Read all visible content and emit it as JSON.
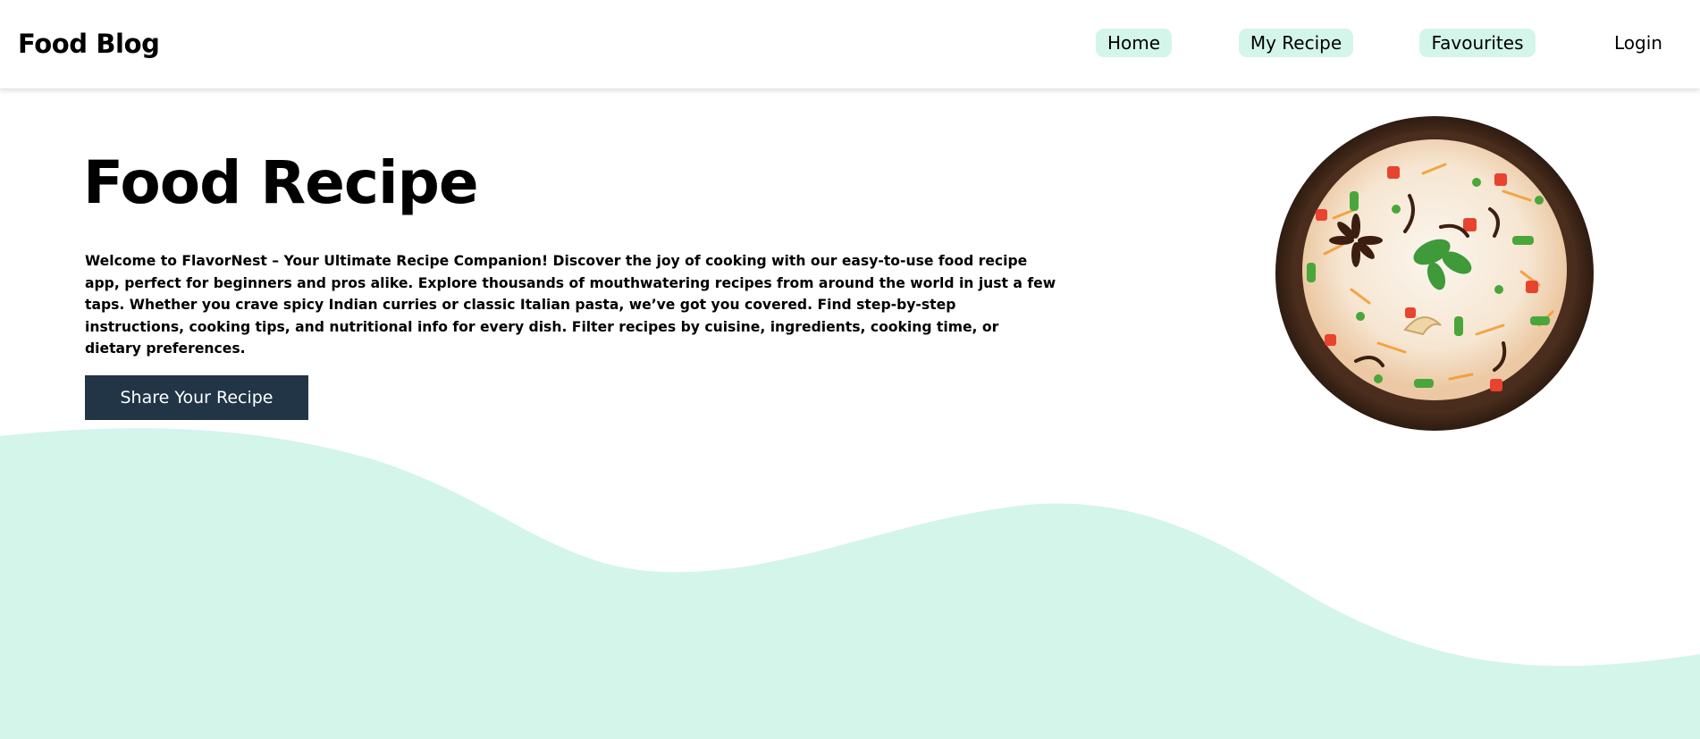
{
  "header": {
    "brand": "Food Blog",
    "nav": {
      "home": "Home",
      "my_recipe": "My Recipe",
      "favourites": "Favourites",
      "login": "Login"
    }
  },
  "hero": {
    "title": "Food Recipe",
    "description": "Welcome to FlavorNest – Your Ultimate Recipe Companion! Discover the joy of cooking with our easy-to-use food recipe app, perfect for beginners and pros alike. Explore thousands of mouthwatering recipes from around the world in just a few taps. Whether you crave spicy Indian curries or classic Italian pasta, we’ve got you covered. Find step-by-step instructions, cooking tips, and nutritional info for every dish. Filter recipes by cuisine, ingredients, cooking time, or dietary preferences.",
    "cta_label": "Share Your Recipe",
    "image": "biryani-bowl-image"
  },
  "colors": {
    "accent_mint": "#d4f5e9",
    "button_navy": "#213547",
    "text": "#000000",
    "background": "#ffffff"
  }
}
